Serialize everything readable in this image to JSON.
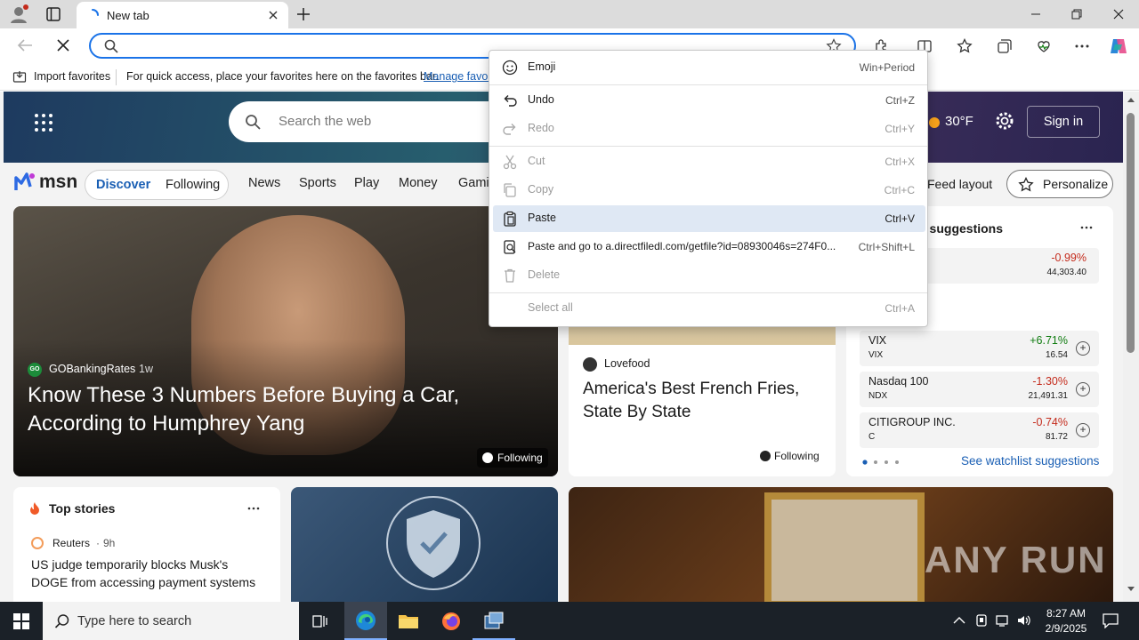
{
  "browser": {
    "tab_title": "New tab",
    "address_placeholder": "",
    "favorites_bar": {
      "import_label": "Import favorites",
      "hint_text": "For quick access, place your favorites here on the favorites bar.",
      "manage_link": "Manage favori"
    }
  },
  "msn": {
    "search_placeholder": "Search the web",
    "weather_temp": "30°F",
    "sign_in": "Sign in",
    "logo_text": "msn",
    "tabs": [
      "Discover",
      "Following"
    ],
    "nav_links": [
      "News",
      "Sports",
      "Play",
      "Money",
      "Gamin"
    ],
    "feed_layout": "Feed layout",
    "personalize": "Personalize",
    "hero_card": {
      "source": "GOBankingRates",
      "age": "1w",
      "headline": "Know These 3 Numbers Before Buying a Car, According to Humphrey Yang",
      "follow_badge": "Following"
    },
    "food_card": {
      "source": "Lovefood",
      "headline": "America's Best French Fries, State By State",
      "follow_badge": "Following"
    },
    "watchlist": {
      "title": "t suggestions",
      "stocks": [
        {
          "name": "",
          "symbol": "",
          "change": "-0.99%",
          "price": "44,303.40"
        },
        {
          "name": "VIX",
          "symbol": "VIX",
          "change": "+6.71%",
          "price": "16.54"
        },
        {
          "name": "Nasdaq 100",
          "symbol": "NDX",
          "change": "-1.30%",
          "price": "21,491.31"
        },
        {
          "name": "CITIGROUP INC.",
          "symbol": "C",
          "change": "-0.74%",
          "price": "81.72"
        }
      ],
      "see_more": "See watchlist suggestions"
    },
    "top_stories": {
      "title": "Top stories",
      "source": "Reuters",
      "age": "9h",
      "headline": "US judge temporarily blocks Musk's DOGE from accessing payment systems"
    },
    "watermark": "ANY RUN"
  },
  "context_menu": {
    "items": [
      {
        "label": "Emoji",
        "shortcut": "Win+Period",
        "icon": "emoji-icon"
      },
      {
        "label": "Undo",
        "shortcut": "Ctrl+Z",
        "icon": "undo-icon"
      },
      {
        "label": "Redo",
        "shortcut": "Ctrl+Y",
        "icon": "redo-icon"
      },
      {
        "label": "Cut",
        "shortcut": "Ctrl+X",
        "icon": "cut-icon"
      },
      {
        "label": "Copy",
        "shortcut": "Ctrl+C",
        "icon": "copy-icon"
      },
      {
        "label": "Paste",
        "shortcut": "Ctrl+V",
        "icon": "paste-icon"
      },
      {
        "label": "Paste and go to a.directfiledl.com/getfile?id=08930046s=274F0...",
        "shortcut": "Ctrl+Shift+L",
        "icon": "paste-go-icon"
      },
      {
        "label": "Delete",
        "shortcut": "",
        "icon": "delete-icon"
      },
      {
        "label": "Select all",
        "shortcut": "Ctrl+A",
        "icon": ""
      }
    ]
  },
  "taskbar": {
    "search_placeholder": "Type here to search",
    "time": "8:27 AM",
    "date": "2/9/2025"
  },
  "colors": {
    "accent": "#1a73e8",
    "negative": "#c42b1c",
    "positive": "#107c10",
    "menu_highlight": "#dfe8f4"
  }
}
